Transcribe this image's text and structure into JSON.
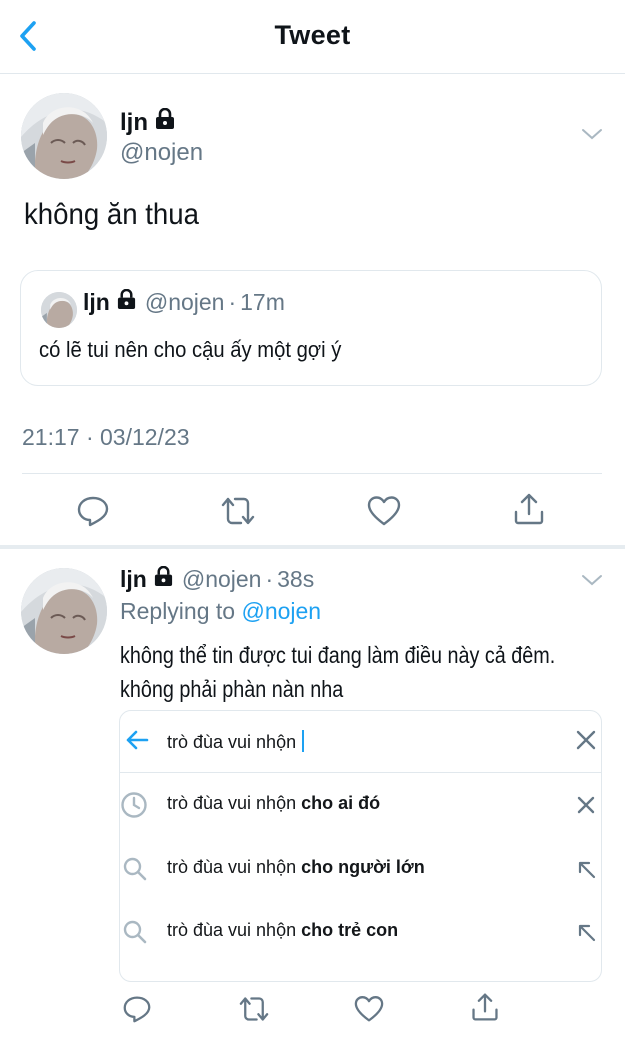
{
  "header": {
    "title": "Tweet"
  },
  "tweet": {
    "name": "ljn",
    "handle": "@nojen",
    "text": "không ăn thua",
    "timestamp": "21:17 · 03/12/23"
  },
  "quoted": {
    "name": "ljn",
    "handle": "@nojen",
    "sep": "·",
    "time": "17m",
    "text": "có lẽ tui nên cho cậu ấy một gợi ý"
  },
  "reply": {
    "name": "ljn",
    "handle": "@nojen",
    "sep": "·",
    "time": "38s",
    "replying_prefix": "Replying to",
    "replying_to": "@nojen",
    "line1": "không thể tin được tui đang làm điều này cả đêm.",
    "line2": "không phải phàn nàn nha"
  },
  "search": {
    "query": "trò đùa vui nhộn",
    "suggestions": [
      {
        "type": "recent",
        "prefix": "trò đùa vui nhộn",
        "suffix": "cho ai đó",
        "action_icon": "close-icon"
      },
      {
        "type": "search",
        "prefix": "trò đùa vui nhộn",
        "suffix": "cho người lớn",
        "action_icon": "arrow-up-left-icon"
      },
      {
        "type": "search",
        "prefix": "trò đùa vui nhộn",
        "suffix": "cho trẻ con",
        "action_icon": "arrow-up-left-icon"
      }
    ]
  },
  "colors": {
    "accent": "#1da1f2",
    "muted": "#657786",
    "border": "#e1e8ed",
    "text": "#0f1419"
  }
}
